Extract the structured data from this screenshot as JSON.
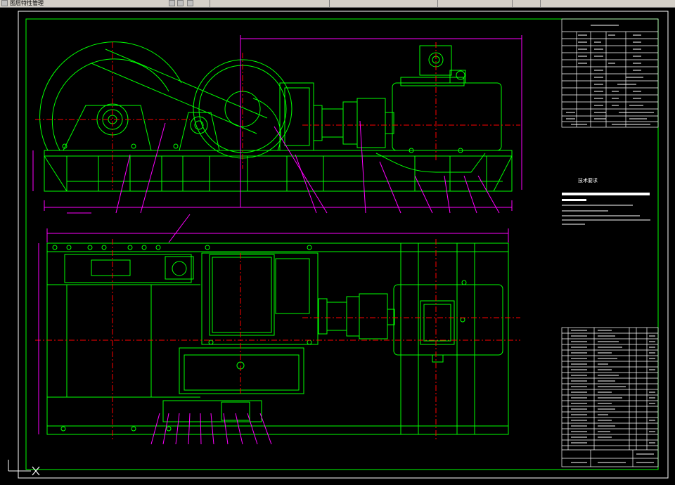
{
  "app": {
    "toolbar_segments": [
      "图层特性管理",
      "",
      "",
      "",
      "",
      ""
    ]
  },
  "title_block": {
    "rows": [
      "",
      "",
      "",
      "",
      "",
      "",
      "",
      "",
      "",
      "",
      "",
      "",
      "",
      "",
      "",
      ""
    ]
  },
  "drawing": {
    "tech_req_title": "技术要求",
    "tech_req_lines": [
      "",
      "",
      "",
      "",
      ""
    ]
  },
  "colors": {
    "background": "#000000",
    "geometry": "#00ff00",
    "centerline": "#ff0000",
    "dimension": "#ff00ff",
    "text": "#ffffff",
    "frame": "#00ff00"
  }
}
